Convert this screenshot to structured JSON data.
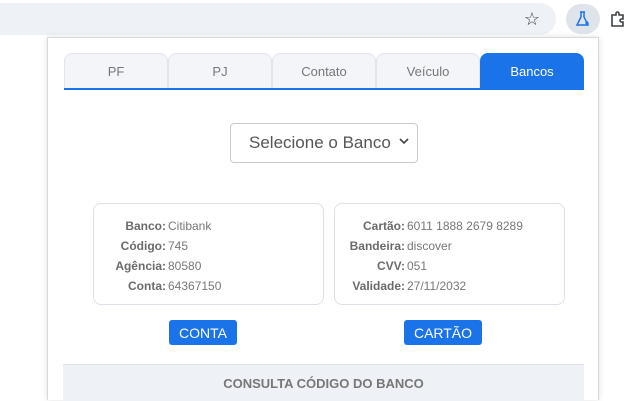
{
  "tabs": [
    {
      "label": "PF",
      "active": false
    },
    {
      "label": "PJ",
      "active": false
    },
    {
      "label": "Contato",
      "active": false
    },
    {
      "label": "Veículo",
      "active": false
    },
    {
      "label": "Bancos",
      "active": true
    }
  ],
  "bank_select": {
    "selected": "Selecione o Banco"
  },
  "account": {
    "bank_label": "Banco:",
    "bank": "Citibank",
    "code_label": "Código:",
    "code": "745",
    "agency_label": "Agência:",
    "agency": "80580",
    "account_label": "Conta:",
    "account": "64367150"
  },
  "card": {
    "card_label": "Cartão:",
    "number": "6011 1888 2679 8289",
    "brand_label": "Bandeira:",
    "brand": "discover",
    "cvv_label": "CVV:",
    "cvv": "051",
    "validity_label": "Validade:",
    "validity": "27/11/2032"
  },
  "buttons": {
    "conta": "CONTA",
    "cartao": "CARTÃO"
  },
  "footer": {
    "title": "CONSULTA CÓDIGO DO BANCO"
  },
  "icons": {
    "bookmark": "star-icon",
    "extension_active": "flask-icon",
    "extensions": "puzzle-icon"
  },
  "colors": {
    "accent": "#1a73e8"
  }
}
